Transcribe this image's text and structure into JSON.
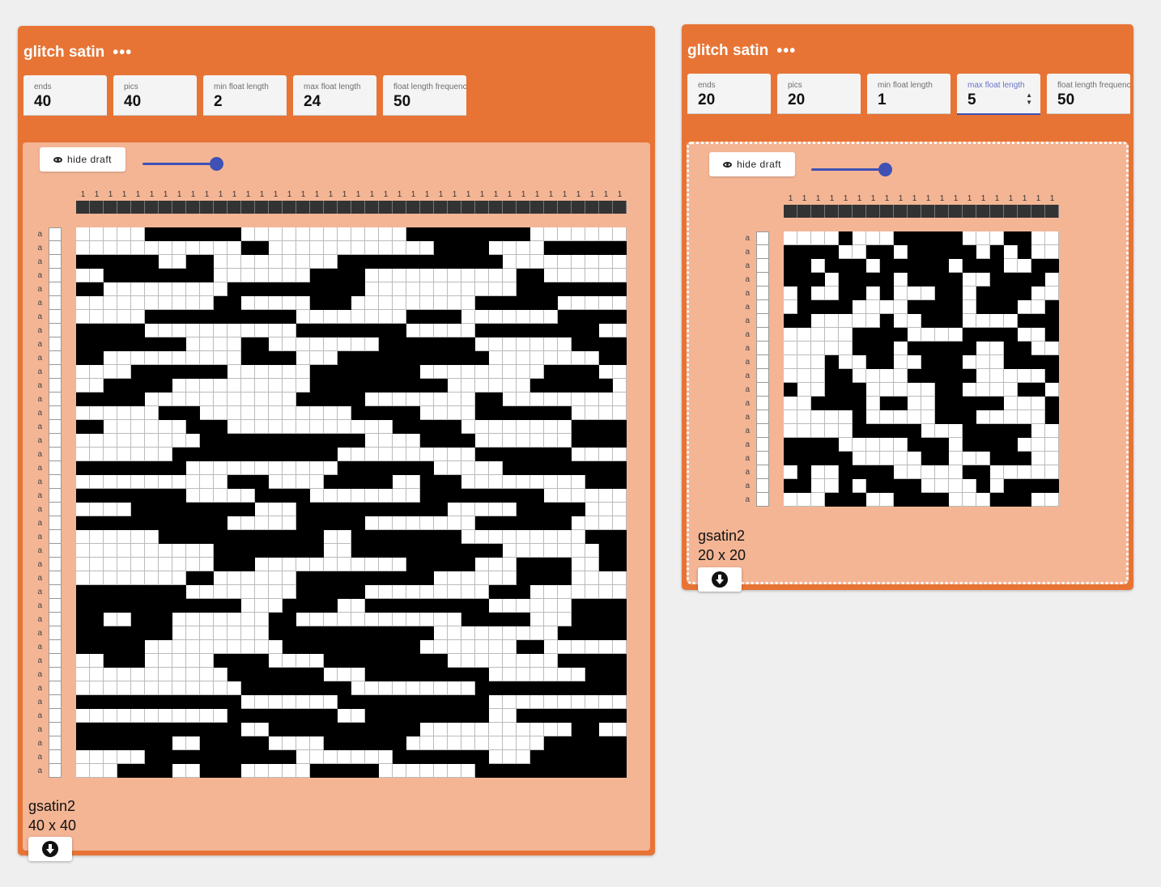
{
  "operations": [
    {
      "title": "glitch satin",
      "menu_icon": "more-horizontal-icon",
      "params": [
        {
          "label": "ends",
          "value": "40"
        },
        {
          "label": "pics",
          "value": "40"
        },
        {
          "label": "min float length",
          "value": "2"
        },
        {
          "label": "max float length",
          "value": "24"
        },
        {
          "label": "float length frequency",
          "value": "50"
        }
      ],
      "hide_draft_label": "hide draft",
      "draft_name": "gsatin2",
      "draft_size": "40 x 40",
      "warp_marker": "1",
      "weft_marker": "a",
      "download_icon": "download-icon",
      "colors": {
        "accent": "#e77435",
        "draft_bg": "#f4b595",
        "slider": "#3f51b5"
      }
    },
    {
      "title": "glitch satin",
      "menu_icon": "more-horizontal-icon",
      "params": [
        {
          "label": "ends",
          "value": "20"
        },
        {
          "label": "pics",
          "value": "20"
        },
        {
          "label": "min float length",
          "value": "1"
        },
        {
          "label": "max float length",
          "value": "5"
        },
        {
          "label": "float length frequency",
          "value": "50"
        }
      ],
      "hide_draft_label": "hide draft",
      "draft_name": "gsatin2",
      "draft_size": "20 x 20",
      "warp_marker": "1",
      "weft_marker": "a",
      "download_icon": "download-icon",
      "colors": {
        "accent": "#e77435",
        "draft_bg": "#f4b595",
        "slider": "#3f51b5"
      }
    }
  ]
}
